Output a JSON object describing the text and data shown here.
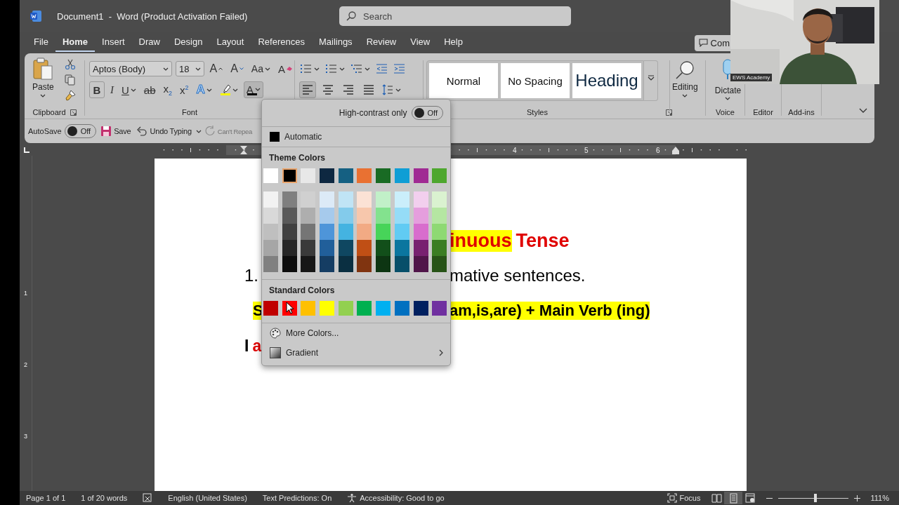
{
  "window": {
    "title": "Document1  -  Word (Product Activation Failed)"
  },
  "search": {
    "placeholder": "Search"
  },
  "comments_button": {
    "label": "Com"
  },
  "tabs": [
    {
      "label": "File",
      "selected": false
    },
    {
      "label": "Home",
      "selected": true
    },
    {
      "label": "Insert",
      "selected": false
    },
    {
      "label": "Draw",
      "selected": false
    },
    {
      "label": "Design",
      "selected": false
    },
    {
      "label": "Layout",
      "selected": false
    },
    {
      "label": "References",
      "selected": false
    },
    {
      "label": "Mailings",
      "selected": false
    },
    {
      "label": "Review",
      "selected": false
    },
    {
      "label": "View",
      "selected": false
    },
    {
      "label": "Help",
      "selected": false
    }
  ],
  "ribbon": {
    "clipboard": {
      "paste": "Paste",
      "group": "Clipboard"
    },
    "font": {
      "font_name": "Aptos (Body)",
      "font_size": "18",
      "group": "Font",
      "row1": [
        {
          "kind": "grow",
          "glyph": "A"
        },
        {
          "kind": "shrink",
          "glyph": "A"
        },
        {
          "kind": "case",
          "glyph": "Aa"
        },
        {
          "kind": "clear",
          "glyph": "A"
        }
      ],
      "row2": [
        {
          "kind": "bold",
          "glyph": "B"
        },
        {
          "kind": "italic",
          "glyph": "I"
        },
        {
          "kind": "underline",
          "glyph": "U"
        },
        {
          "kind": "strike",
          "glyph": "ab"
        },
        {
          "kind": "subscript",
          "glyph": "x$_{2}$"
        },
        {
          "kind": "superscript",
          "glyph": "x$^{2}$"
        },
        {
          "kind": "effects",
          "glyph": "A"
        },
        {
          "kind": "highlight"
        },
        {
          "kind": "fontcolor",
          "glyph": "A",
          "open": true
        }
      ]
    },
    "paragraph": {
      "row1": [
        {
          "kind": "bullets"
        },
        {
          "kind": "numbering"
        },
        {
          "kind": "multilevel"
        },
        {
          "kind": "outdent"
        },
        {
          "kind": "indent"
        }
      ],
      "align": [
        {
          "kind": "left",
          "selected": true
        },
        {
          "kind": "center",
          "selected": false
        },
        {
          "kind": "right",
          "selected": false
        },
        {
          "kind": "justify",
          "selected": false
        }
      ]
    },
    "styles": {
      "items": [
        {
          "label": "Normal",
          "kind": "body"
        },
        {
          "label": "No Spacing",
          "kind": "body"
        },
        {
          "label": "Heading",
          "kind": "heading"
        }
      ],
      "group": "Styles"
    },
    "editing": {
      "label": "Editing"
    },
    "voice": {
      "label": "Dictate",
      "group": "Voice"
    },
    "editor": {
      "group": "Editor"
    },
    "addins": {
      "group": "Add-ins"
    }
  },
  "quick_access": {
    "autosave": {
      "label": "AutoSave",
      "on": false,
      "state_text": "Off"
    },
    "save": "Save",
    "undo": "Undo Typing",
    "redo": {
      "label": "Can't Repea",
      "disabled": true
    }
  },
  "color_menu": {
    "high_contrast": {
      "label": "High-contrast only",
      "on": false,
      "state_text": "Off"
    },
    "automatic": "Automatic",
    "theme_title": "Theme Colors",
    "theme_colors": [
      {
        "color": "#ffffff",
        "selected": false
      },
      {
        "color": "#000000",
        "selected": true
      },
      {
        "color": "#e8e8e8",
        "selected": false
      },
      {
        "color": "#0e2841",
        "selected": false
      },
      {
        "color": "#156082",
        "selected": false
      },
      {
        "color": "#e97132",
        "selected": false
      },
      {
        "color": "#196b24",
        "selected": false
      },
      {
        "color": "#0f9ed5",
        "selected": false
      },
      {
        "color": "#a02b93",
        "selected": false
      },
      {
        "color": "#4ea72e",
        "selected": false
      }
    ],
    "shades": [
      {
        "shades": [
          {
            "color": "#f2f2f2",
            "selected": false
          },
          {
            "color": "#d9d9d9",
            "selected": false
          },
          {
            "color": "#bfbfbf",
            "selected": false
          },
          {
            "color": "#a6a6a6",
            "selected": false
          },
          {
            "color": "#808080",
            "selected": false
          }
        ]
      },
      {
        "shades": [
          {
            "color": "#7f7f7f",
            "selected": false
          },
          {
            "color": "#595959",
            "selected": false
          },
          {
            "color": "#404040",
            "selected": false
          },
          {
            "color": "#262626",
            "selected": false
          },
          {
            "color": "#0d0d0d",
            "selected": false
          }
        ]
      },
      {
        "shades": [
          {
            "color": "#d0d0d0",
            "selected": false
          },
          {
            "color": "#aeaeae",
            "selected": false
          },
          {
            "color": "#757575",
            "selected": false
          },
          {
            "color": "#3a3a3a",
            "selected": false
          },
          {
            "color": "#171717",
            "selected": false
          }
        ]
      },
      {
        "shades": [
          {
            "color": "#dceaf7",
            "selected": false
          },
          {
            "color": "#a6caec",
            "selected": false
          },
          {
            "color": "#4e95d9",
            "selected": false
          },
          {
            "color": "#215f9a",
            "selected": false
          },
          {
            "color": "#153d63",
            "selected": false
          }
        ]
      },
      {
        "shades": [
          {
            "color": "#c0e4f5",
            "selected": false
          },
          {
            "color": "#83cbeb",
            "selected": false
          },
          {
            "color": "#44b3e1",
            "selected": false
          },
          {
            "color": "#0f4761",
            "selected": false
          },
          {
            "color": "#0a2f41",
            "selected": false
          }
        ]
      },
      {
        "shades": [
          {
            "color": "#fbe2d5",
            "selected": false
          },
          {
            "color": "#f7c7ac",
            "selected": false
          },
          {
            "color": "#f2aa84",
            "selected": false
          },
          {
            "color": "#c04f15",
            "selected": false
          },
          {
            "color": "#803410",
            "selected": false
          }
        ]
      },
      {
        "shades": [
          {
            "color": "#c1f0c8",
            "selected": false
          },
          {
            "color": "#83e28e",
            "selected": false
          },
          {
            "color": "#47d459",
            "selected": false
          },
          {
            "color": "#124f1a",
            "selected": false
          },
          {
            "color": "#0d3512",
            "selected": false
          }
        ]
      },
      {
        "shades": [
          {
            "color": "#caeefb",
            "selected": false
          },
          {
            "color": "#95dcf7",
            "selected": false
          },
          {
            "color": "#61cbf3",
            "selected": false
          },
          {
            "color": "#0b769f",
            "selected": false
          },
          {
            "color": "#074f6a",
            "selected": false
          }
        ]
      },
      {
        "shades": [
          {
            "color": "#f2cfee",
            "selected": false
          },
          {
            "color": "#e59edd",
            "selected": false
          },
          {
            "color": "#d86dcd",
            "selected": false
          },
          {
            "color": "#782170",
            "selected": false
          },
          {
            "color": "#501549",
            "selected": false
          }
        ]
      },
      {
        "shades": [
          {
            "color": "#daf2d0",
            "selected": false
          },
          {
            "color": "#b5e6a2",
            "selected": false
          },
          {
            "color": "#8ed973",
            "selected": false
          },
          {
            "color": "#3b7d23",
            "selected": false
          },
          {
            "color": "#275317",
            "selected": false
          }
        ]
      }
    ],
    "standard_title": "Standard Colors",
    "standard_colors": [
      {
        "color": "#c00000",
        "selected": false
      },
      {
        "color": "#ff0000",
        "selected": false
      },
      {
        "color": "#ffc000",
        "selected": false
      },
      {
        "color": "#ffff00",
        "selected": false
      },
      {
        "color": "#92d050",
        "selected": false
      },
      {
        "color": "#00b050",
        "selected": false
      },
      {
        "color": "#00b0f0",
        "selected": false
      },
      {
        "color": "#0070c0",
        "selected": false
      },
      {
        "color": "#002060",
        "selected": false
      },
      {
        "color": "#7030a0",
        "selected": false
      }
    ],
    "more_colors": "More Colors...",
    "gradient": "Gradient"
  },
  "ruler": {
    "numbers": [
      "4",
      "5",
      "6"
    ],
    "vertical_numbers": [
      "1",
      "2",
      "3"
    ]
  },
  "document": {
    "lines": [
      {
        "kind": "heading",
        "right": [
          {
            "text": "inuous",
            "highlight": true,
            "kind": "accent"
          },
          {
            "text": "Tense",
            "highlight": false,
            "kind": "accent"
          }
        ]
      },
      {
        "kind": "list",
        "left": [
          {
            "text": "1.",
            "highlight": false,
            "kind": "plain"
          }
        ],
        "right": [
          {
            "text": "mative sentences.",
            "highlight": false,
            "kind": "plain"
          }
        ]
      },
      {
        "kind": "formula",
        "left": [
          {
            "text": "S",
            "highlight": true,
            "kind": "plain"
          }
        ],
        "right": [
          {
            "text": "am,is,are) + Main Verb (ing)",
            "highlight": true,
            "kind": "plain"
          }
        ]
      },
      {
        "kind": "example",
        "left": [
          {
            "text": "I",
            "highlight": false,
            "kind": "plain"
          },
          {
            "text": "a",
            "highlight": false,
            "kind": "accent"
          }
        ]
      }
    ]
  },
  "webcam": {
    "label": "EWS Academy",
    "kind": "picture"
  },
  "status_bar": {
    "page": "Page 1 of 1",
    "words": "1 of 20 words",
    "language": "English (United States)",
    "predictions": "Text Predictions: On",
    "accessibility": "Accessibility: Good to go",
    "focus": "Focus",
    "views": [
      {
        "kind": "read",
        "selected": false
      },
      {
        "kind": "print",
        "selected": true
      },
      {
        "kind": "web",
        "selected": false
      }
    ],
    "zoom": {
      "level": 0.53,
      "reading": "111%"
    }
  }
}
